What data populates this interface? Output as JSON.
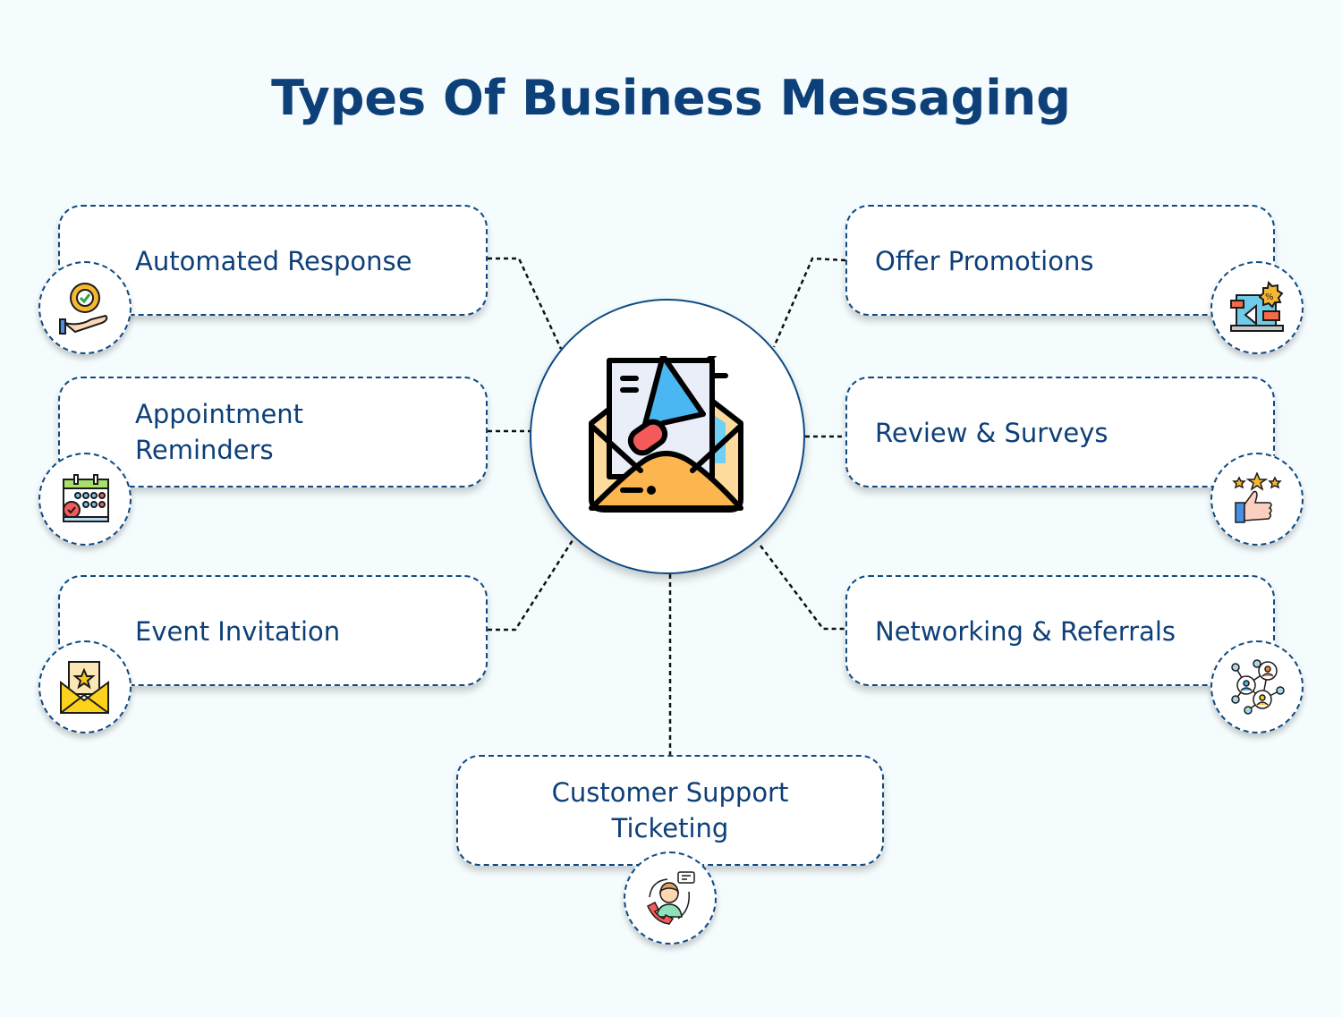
{
  "title": "Types Of Business Messaging",
  "center": {
    "icon": "megaphone-envelope-icon"
  },
  "colors": {
    "background": "#f5fcfe",
    "title": "#0d3f78",
    "card_border": "#0d4a82",
    "connector": "#111111"
  },
  "items": [
    {
      "label_lines": [
        "Automated Response"
      ],
      "icon": "gear-hand-icon",
      "side": "left"
    },
    {
      "label_lines": [
        "Appointment",
        "Reminders"
      ],
      "icon": "calendar-check-icon",
      "side": "left"
    },
    {
      "label_lines": [
        "Event Invitation"
      ],
      "icon": "invitation-envelope-icon",
      "side": "left"
    },
    {
      "label_lines": [
        "Offer Promotions"
      ],
      "icon": "laptop-promotion-icon",
      "side": "right"
    },
    {
      "label_lines": [
        "Review & Surveys"
      ],
      "icon": "thumbs-up-stars-icon",
      "side": "right"
    },
    {
      "label_lines": [
        "Networking & Referrals"
      ],
      "icon": "network-people-icon",
      "side": "right"
    },
    {
      "label_lines": [
        "Customer Support",
        "Ticketing"
      ],
      "icon": "support-agent-icon",
      "side": "bottom"
    }
  ]
}
